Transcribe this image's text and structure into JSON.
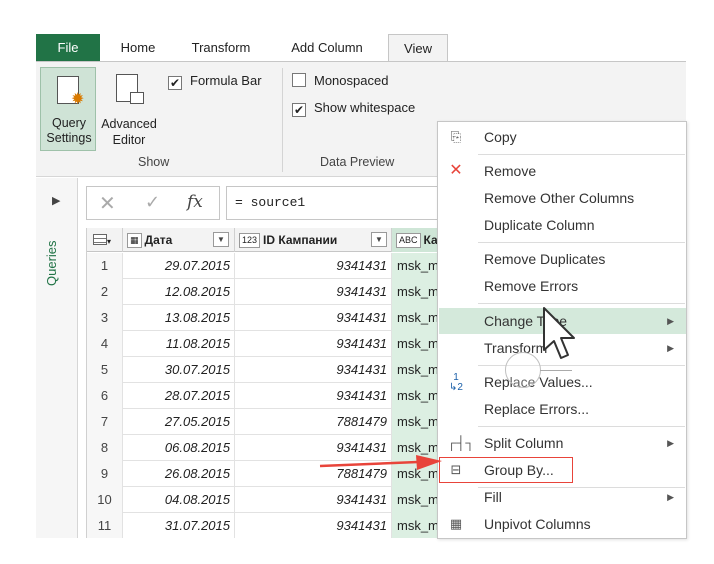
{
  "ribbon": {
    "tabs": [
      "File",
      "Home",
      "Transform",
      "Add Column",
      "View"
    ],
    "active_tab": "View",
    "query_settings_label": "Query Settings",
    "advanced_editor_label": "Advanced Editor",
    "formula_bar_label": "Formula Bar",
    "monospaced_label": "Monospaced",
    "show_whitespace_label": "Show whitespace",
    "group_show": "Show",
    "group_data_preview": "Data Preview"
  },
  "queries_pane": {
    "label": "Queries"
  },
  "formula_bar": {
    "fx": "fx",
    "formula": "= source1"
  },
  "grid": {
    "columns": [
      "Дата",
      "ID Кампании",
      "Ка"
    ],
    "column_type_icons": [
      "calendar",
      "123",
      "ABC"
    ],
    "rows": [
      {
        "idx": "1",
        "date": "29.07.2015",
        "id": "9341431",
        "text": "msk_m"
      },
      {
        "idx": "2",
        "date": "12.08.2015",
        "id": "9341431",
        "text": "msk_m"
      },
      {
        "idx": "3",
        "date": "13.08.2015",
        "id": "9341431",
        "text": "msk_m"
      },
      {
        "idx": "4",
        "date": "11.08.2015",
        "id": "9341431",
        "text": "msk_m"
      },
      {
        "idx": "5",
        "date": "30.07.2015",
        "id": "9341431",
        "text": "msk_m"
      },
      {
        "idx": "6",
        "date": "28.07.2015",
        "id": "9341431",
        "text": "msk_m"
      },
      {
        "idx": "7",
        "date": "27.05.2015",
        "id": "7881479",
        "text": "msk_m"
      },
      {
        "idx": "8",
        "date": "06.08.2015",
        "id": "9341431",
        "text": "msk_m"
      },
      {
        "idx": "9",
        "date": "26.08.2015",
        "id": "7881479",
        "text": "msk_m"
      },
      {
        "idx": "10",
        "date": "04.08.2015",
        "id": "9341431",
        "text": "msk_m"
      },
      {
        "idx": "11",
        "date": "31.07.2015",
        "id": "9341431",
        "text": "msk_m"
      }
    ]
  },
  "context_menu": {
    "items": [
      {
        "label": "Copy"
      },
      {
        "label": "Remove"
      },
      {
        "label": "Remove Other Columns"
      },
      {
        "label": "Duplicate Column"
      },
      {
        "label": "Remove Duplicates"
      },
      {
        "label": "Remove Errors"
      },
      {
        "label": "Change Type"
      },
      {
        "label": "Transform"
      },
      {
        "label": "Replace Values..."
      },
      {
        "label": "Replace Errors..."
      },
      {
        "label": "Split Column"
      },
      {
        "label": "Group By..."
      },
      {
        "label": "Fill"
      },
      {
        "label": "Unpivot Columns"
      }
    ],
    "highlighted": "Change Type",
    "callout": "Group By..."
  },
  "colors": {
    "accent": "#217346",
    "highlight": "#d4e9db",
    "callout": "#e8443a"
  }
}
